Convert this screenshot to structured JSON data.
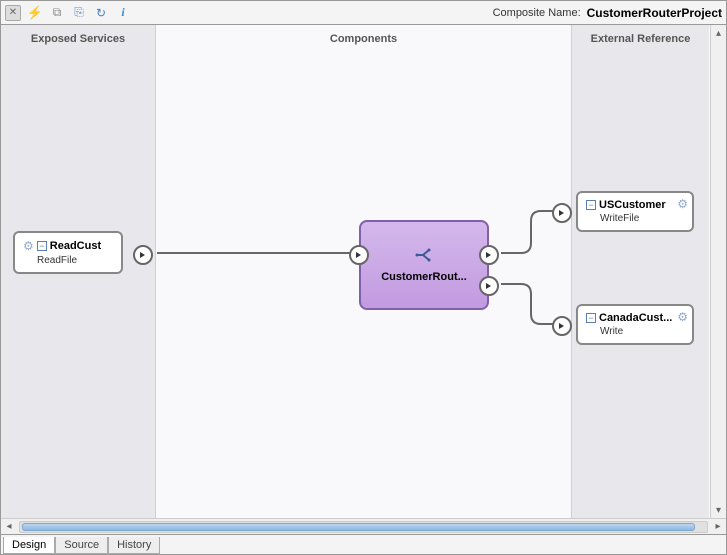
{
  "header": {
    "composite_label": "Composite Name:",
    "composite_name": "CustomerRouterProject"
  },
  "lanes": {
    "left": "Exposed Services",
    "mid": "Components",
    "right": "External Reference"
  },
  "services": {
    "read": {
      "title": "ReadCust",
      "sub": "ReadFile"
    },
    "us": {
      "title": "USCustomer",
      "sub": "WriteFile"
    },
    "canada": {
      "title": "CanadaCust...",
      "sub": "Write"
    }
  },
  "component": {
    "title": "CustomerRout..."
  },
  "tabs": {
    "design": "Design",
    "source": "Source",
    "history": "History"
  }
}
